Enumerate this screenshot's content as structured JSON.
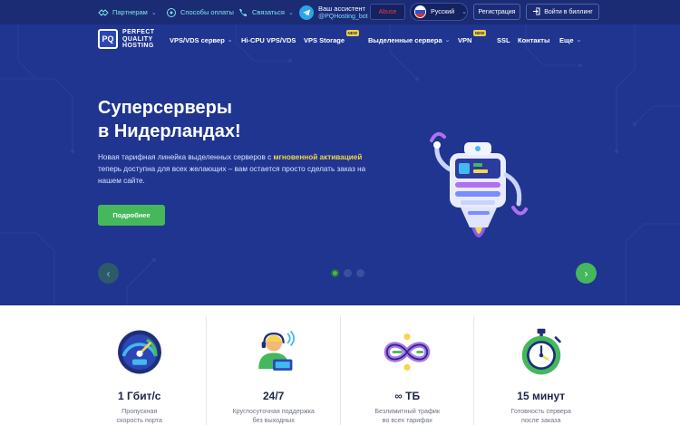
{
  "topbar": {
    "partners": "Партнерам",
    "payment": "Способы оплаты",
    "contact": "Связаться",
    "assistant_title": "Ваш ассистент",
    "assistant_handle": "@PQHosting_bot",
    "abuse": "Abuse",
    "language": "Русский",
    "register": "Регистрация",
    "billing": "Войти в биллинг"
  },
  "nav": {
    "logo_mark": "PQ",
    "logo_line1": "PERFECT",
    "logo_line2": "QUALITY",
    "logo_line3": "HOSTING",
    "items": [
      {
        "label": "VPS/VDS сервер"
      },
      {
        "label": "Hi-CPU VPS/VDS"
      },
      {
        "label": "VPS Storage",
        "badge": "NEW"
      },
      {
        "label": "Выделенные сервера"
      },
      {
        "label": "VPN",
        "badge": "NEW"
      },
      {
        "label": "SSL"
      },
      {
        "label": "Контакты"
      },
      {
        "label": "Еще"
      }
    ]
  },
  "hero": {
    "title_line1": "Суперсерверы",
    "title_line2": "в Нидерландах!",
    "desc_part1": "Новая тарифная линейка выделенных серверов с ",
    "desc_highlight": "мгновенной активацией",
    "desc_part2": " теперь доступна для всех желающих – вам остается просто сделать заказ на нашем сайте.",
    "button": "Подробнее",
    "slides_total": 3,
    "slide_active": 1
  },
  "features": [
    {
      "icon": "speedometer-icon",
      "value": "1 Гбит/с",
      "line1": "Пропускная",
      "line2": "скорость порта"
    },
    {
      "icon": "support-operator-icon",
      "value": "24/7",
      "line1": "Круглосуточная поддержка",
      "line2": "без выходных"
    },
    {
      "icon": "infinity-traffic-icon",
      "value": "∞ ТБ",
      "line1": "Безлимитный трафик",
      "line2": "во всех тарифах"
    },
    {
      "icon": "stopwatch-icon",
      "value": "15 минут",
      "line1": "Готовность сервера",
      "line2": "после заказа"
    }
  ],
  "colors": {
    "topbar_bg": "#1b2c75",
    "hero_bg": "#1f3590",
    "accent_green": "#44b85a",
    "highlight_yellow": "#f6d54a",
    "link_cyan": "#7fe3ea"
  }
}
